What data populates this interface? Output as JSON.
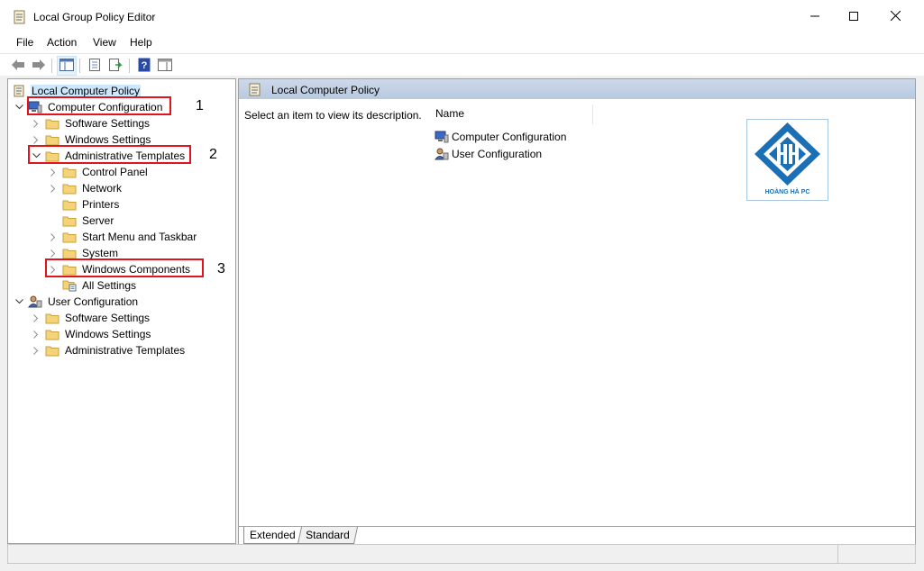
{
  "window": {
    "title": "Local Group Policy Editor",
    "icon": "policy-scroll-icon",
    "controls": [
      "minimize-icon",
      "maximize-icon",
      "close-icon"
    ]
  },
  "menu": {
    "items": [
      "File",
      "Action",
      "View",
      "Help"
    ]
  },
  "toolbar": {
    "buttons": [
      "back-arrow-icon",
      "forward-arrow-icon",
      "show-hide-console-tree-icon",
      "properties-icon",
      "export-list-icon",
      "help-icon",
      "show-hide-action-pane-icon"
    ]
  },
  "tree": {
    "root": {
      "label": "Local Computer Policy",
      "icon": "policy-scroll-icon"
    },
    "computer_configuration": {
      "label": "Computer Configuration",
      "children": {
        "software_settings": "Software Settings",
        "windows_settings": "Windows Settings",
        "administrative_templates": {
          "label": "Administrative Templates",
          "children": {
            "control_panel": "Control Panel",
            "network": "Network",
            "printers": "Printers",
            "server": "Server",
            "start_menu": "Start Menu and Taskbar",
            "system": "System",
            "windows_components": "Windows Components",
            "all_settings": "All Settings"
          }
        }
      }
    },
    "user_configuration": {
      "label": "User Configuration",
      "children": {
        "software_settings": "Software Settings",
        "windows_settings": "Windows Settings",
        "administrative_templates": "Administrative Templates"
      }
    }
  },
  "annotations": {
    "n1": "1",
    "n2": "2",
    "n3": "3",
    "highlight_color": "#e0141c"
  },
  "details": {
    "header": "Local Computer Policy",
    "description": "Select an item to view its description.",
    "column_name": "Name",
    "items": [
      "Computer Configuration",
      "User Configuration"
    ]
  },
  "watermark": {
    "text": "HOÀNG HÀ PC",
    "color": "#1a6fb5"
  },
  "tabs": {
    "extended": "Extended",
    "standard": "Standard"
  }
}
